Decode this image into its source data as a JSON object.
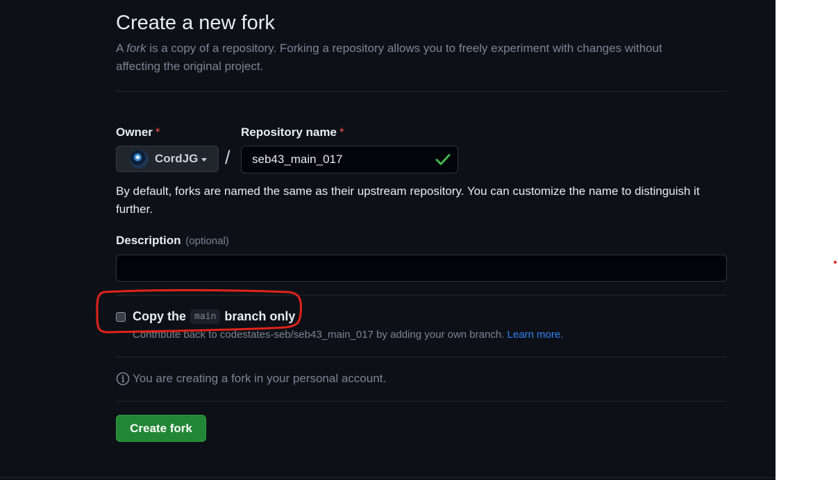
{
  "page": {
    "title": "Create a new fork",
    "subtitle_prefix": "A ",
    "subtitle_em": "fork",
    "subtitle_rest": " is a copy of a repository. Forking a repository allows you to freely experiment with changes without affecting the original project."
  },
  "owner": {
    "label": "Owner",
    "required_mark": "*",
    "selected": "CordJG"
  },
  "separator": "/",
  "repository": {
    "label": "Repository name",
    "required_mark": "*",
    "value": "seb43_main_017",
    "hint": "By default, forks are named the same as their upstream repository. You can customize the name to distinguish it further."
  },
  "description": {
    "label": "Description",
    "optional": "(optional)",
    "value": ""
  },
  "copy_branch": {
    "checked": false,
    "label_prefix": "Copy the",
    "branch": "main",
    "label_suffix": "branch only",
    "note": "Contribute back to codestates-seb/seb43_main_017 by adding your own branch.",
    "learn_more": "Learn more."
  },
  "info": {
    "text": "You are creating a fork in your personal account."
  },
  "create_button": {
    "label": "Create fork"
  },
  "colors": {
    "background": "#0d1117",
    "primary_button": "#238636",
    "link": "#2f81f7",
    "required": "#f85149",
    "success_check": "#3fb950",
    "annotation": "#e2231a"
  }
}
